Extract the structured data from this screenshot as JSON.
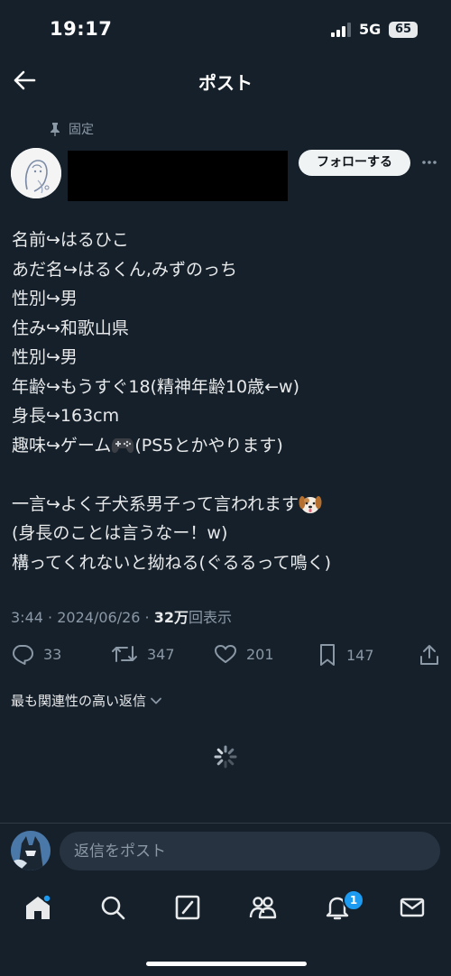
{
  "status_bar": {
    "time": "19:17",
    "network": "5G",
    "battery": "65"
  },
  "header": {
    "title": "ポスト"
  },
  "post": {
    "pinned_label": "固定",
    "follow_label": "フォローする",
    "lines": [
      "名前↪はるひこ",
      "あだ名↪はるくん,みずのっち",
      "性別↪男",
      "住み↪和歌山県",
      "性別↪男",
      "年齢↪もうすぐ18(精神年齢10歳←w)",
      "身長↪163cm",
      "趣味↪ゲーム",
      "",
      "一言↪よく子犬系男子って言われます",
      "(身長のことは言うなー！w)",
      "構ってくれないと拗ねる(ぐるるって鳴く)"
    ],
    "hobby_suffix": "(PS5とかやります)",
    "emoji_gamepad": "controller-emoji",
    "emoji_dog": "dog-emoji",
    "meta": {
      "time": "3:44",
      "separator": "·",
      "date": "2024/06/26",
      "views_count": "32万",
      "views_label": "回表示"
    }
  },
  "actions": {
    "replies": "33",
    "reposts": "347",
    "likes": "201",
    "bookmarks": "147"
  },
  "sort": {
    "label": "最も関連性の高い返信"
  },
  "reply": {
    "placeholder": "返信をポスト"
  },
  "nav": {
    "notifications_badge": "1"
  },
  "colors": {
    "background": "#15202b",
    "text": "#e7e9ea",
    "secondary": "#8b98a5",
    "accent": "#1d9bf0"
  }
}
